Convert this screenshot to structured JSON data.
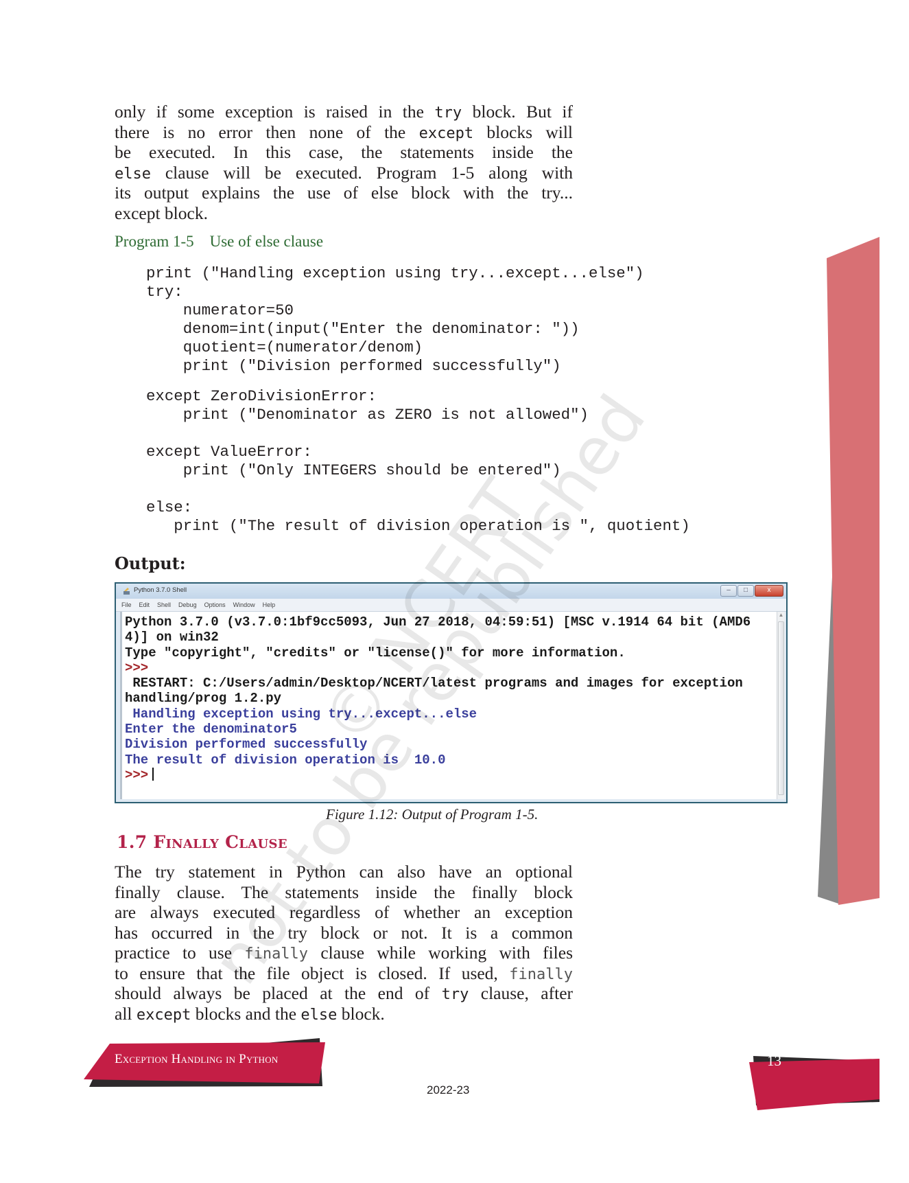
{
  "intro_paragraph": {
    "lines": [
      [
        {
          "t": "only if some exception is raised in the "
        },
        {
          "m": "try"
        },
        {
          "t": " block. But if"
        }
      ],
      [
        {
          "t": "there is no error then none of the "
        },
        {
          "m": "except"
        },
        {
          "t": " blocks will"
        }
      ],
      [
        {
          "t": "be executed. In this case, the statements inside the"
        }
      ],
      [
        {
          "m": "else"
        },
        {
          "t": " clause will be executed. Program 1-5 along with"
        }
      ],
      [
        {
          "t": "its output explains the use of else block with the try..."
        }
      ],
      [
        {
          "t": "except block."
        }
      ]
    ]
  },
  "program_caption": {
    "number": "Program 1-5",
    "title": "Use of else clause"
  },
  "code": {
    "lines": [
      "print (\"Handling exception using try...except...else\")",
      "try:",
      "    numerator=50",
      "    denom=int(input(\"Enter the denominator: \"))",
      "    quotient=(numerator/denom)",
      "    print (\"Division performed successfully\")",
      "",
      "except ZeroDivisionError:",
      "    print (\"Denominator as ZERO is not allowed\")",
      "",
      "except ValueError:",
      "    print (\"Only INTEGERS should be entered\")",
      "",
      "else:",
      "   print (\"The result of division operation is \", quotient)"
    ]
  },
  "output_label": "Output:",
  "shell": {
    "title": "Python 3.7.0 Shell",
    "menu": [
      "File",
      "Edit",
      "Shell",
      "Debug",
      "Options",
      "Window",
      "Help"
    ],
    "buttons": {
      "minimize": "–",
      "maximize": "□",
      "close": "x"
    },
    "lines": [
      {
        "text": "Python 3.7.0 (v3.7.0:1bf9cc5093, Jun 27 2018, 04:59:51) [MSC v.1914 64 bit (AMD6",
        "color": "black"
      },
      {
        "text": "4)] on win32",
        "color": "black"
      },
      {
        "text": "Type \"copyright\", \"credits\" or \"license()\" for more information.",
        "color": "black"
      },
      {
        "text": ">>>",
        "color": "red"
      },
      {
        "text": " RESTART: C:/Users/admin/Desktop/NCERT/latest programs and images for exception",
        "color": "black"
      },
      {
        "text": "handling/prog 1.2.py",
        "color": "black"
      },
      {
        "text": " Handling exception using try...except...else",
        "color": "blue"
      },
      {
        "text": "Enter the denominator5",
        "color": "blue"
      },
      {
        "text": "Division performed successfully",
        "color": "blue"
      },
      {
        "text": "The result of division operation is  10.0",
        "color": "blue"
      },
      {
        "text": ">>>",
        "color": "red",
        "cursor": true
      }
    ]
  },
  "figure_caption": "Figure 1.12:  Output of Program 1-5.",
  "section_heading": "1.7 Finally Clause",
  "finally_paragraph": {
    "lines": [
      [
        {
          "t": "The try statement in Python can also have an optional"
        }
      ],
      [
        {
          "t": "finally clause. The statements inside the finally block"
        }
      ],
      [
        {
          "t": "are always executed regardless of whether an exception"
        }
      ],
      [
        {
          "t": "has occurred in the try block or not. It is a common"
        }
      ],
      [
        {
          "t": "practice to use "
        },
        {
          "ml": "finally"
        },
        {
          "t": " clause while working with files"
        }
      ],
      [
        {
          "t": "to ensure that the file object is closed. If used, "
        },
        {
          "ml": "finally"
        }
      ],
      [
        {
          "t": "should always be placed at the end of "
        },
        {
          "m": "try"
        },
        {
          "t": " clause, after"
        }
      ],
      [
        {
          "t": "all "
        },
        {
          "m": "except"
        },
        {
          "t": " blocks and the "
        },
        {
          "m": "else"
        },
        {
          "t": " block."
        }
      ]
    ]
  },
  "footer": {
    "chapter_title": "Exception Handling in Python",
    "page_number": "13",
    "year": "2022-23"
  },
  "watermark": {
    "line1": "© NCERT",
    "line2": "not to be republished"
  },
  "colors": {
    "accent_red": "#c41e45",
    "side_band_pink": "#d87074",
    "side_band_grey": "#878787",
    "caption_green": "#2e6b33",
    "heading_red": "#b3234a",
    "shell_border": "#2d5f73",
    "shell_blue_text": "#3a3f9c",
    "shell_prompt_red": "#a3262a"
  }
}
